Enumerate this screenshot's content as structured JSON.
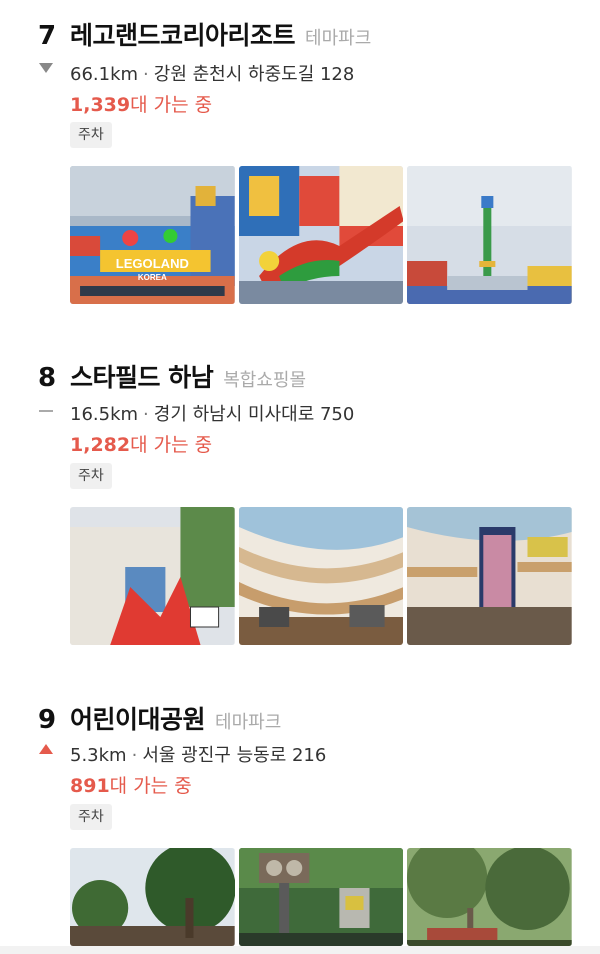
{
  "items": [
    {
      "rank": "7",
      "name": "레고랜드코리아리조트",
      "category": "테마파크",
      "trend": "down",
      "distance": "66.1km",
      "address": "강원 춘천시 하중도길 128",
      "count_number": "1,339",
      "count_suffix": "대 가는 중",
      "tag": "주차"
    },
    {
      "rank": "8",
      "name": "스타필드 하남",
      "category": "복합쇼핑몰",
      "trend": "same",
      "distance": "16.5km",
      "address": "경기 하남시 미사대로 750",
      "count_number": "1,282",
      "count_suffix": "대 가는 중",
      "tag": "주차"
    },
    {
      "rank": "9",
      "name": "어린이대공원",
      "category": "테마파크",
      "trend": "up",
      "distance": "5.3km",
      "address": "서울 광진구 능동로 216",
      "count_number": "891",
      "count_suffix": "대 가는 중",
      "tag": "주차"
    }
  ],
  "photo_labels": {
    "legoland_sign": "LEGOLAND",
    "legoland_sub": "KOREA"
  },
  "colors": {
    "accent": "#e55a4c",
    "trend_down": "#888888",
    "trend_up": "#e55a4c",
    "tag_bg": "#f0f0f0"
  }
}
